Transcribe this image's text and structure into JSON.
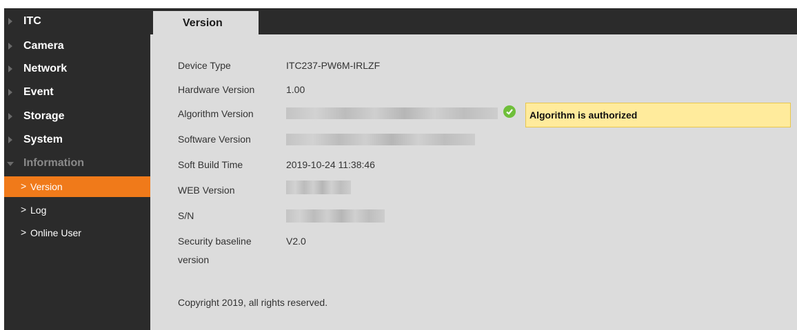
{
  "sidebar": {
    "menu": [
      {
        "label": "ITC"
      },
      {
        "label": "Camera"
      },
      {
        "label": "Network"
      },
      {
        "label": "Event"
      },
      {
        "label": "Storage"
      },
      {
        "label": "System"
      },
      {
        "label": "Information"
      }
    ],
    "sub_items": [
      {
        "label": "Version",
        "active": true
      },
      {
        "label": "Log"
      },
      {
        "label": "Online User"
      }
    ],
    "chevron": ">"
  },
  "tab": {
    "label": "Version"
  },
  "info": {
    "device_type_label": "Device Type",
    "device_type_value": "ITC237-PW6M-IRLZF",
    "hardware_version_label": "Hardware Version",
    "hardware_version_value": "1.00",
    "algorithm_version_label": "Algorithm Version",
    "software_version_label": "Software Version",
    "soft_build_time_label": "Soft Build Time",
    "soft_build_time_value": "2019-10-24 11:38:46",
    "web_version_label": "WEB Version",
    "sn_label": "S/N",
    "security_baseline_label_line1": "Security baseline",
    "security_baseline_label_line2": "version",
    "security_baseline_value": "V2.0"
  },
  "notice": {
    "text": "Algorithm is authorized"
  },
  "footer": {
    "copyright": "Copyright 2019, all rights reserved."
  },
  "colors": {
    "sidebar_bg": "#2b2b2b",
    "active_item": "#f07a1a",
    "content_bg": "#dcdcdc",
    "notice_bg": "#ffeb9c",
    "success": "#6fbf3a"
  },
  "icons": [
    "collapsed-arrow-icon",
    "expanded-arrow-icon",
    "chevron-right-icon",
    "check-icon"
  ]
}
